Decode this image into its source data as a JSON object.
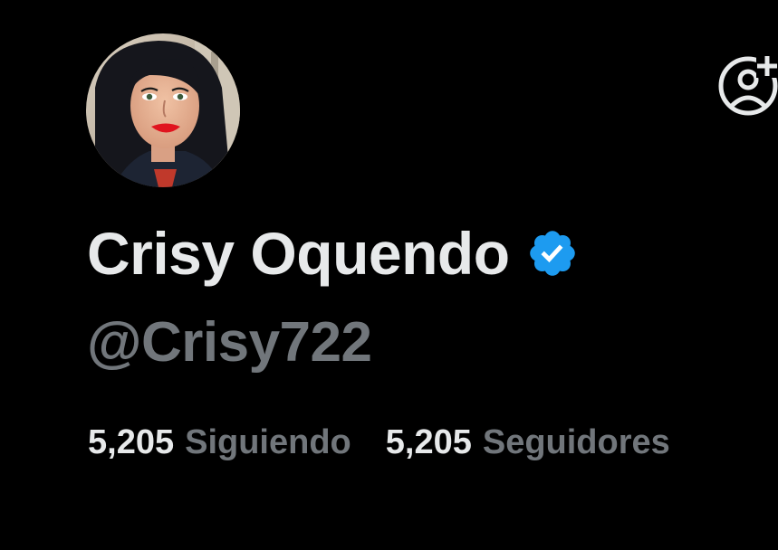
{
  "profile": {
    "display_name": "Crisy Oquendo",
    "handle": "@Crisy722",
    "verified": true
  },
  "stats": {
    "following_count": "5,205",
    "following_label": "Siguiendo",
    "followers_count": "5,205",
    "followers_label": "Seguidores"
  },
  "icons": {
    "avatar": "profile-photo",
    "verified": "verified-badge-icon",
    "follow": "add-user-icon"
  },
  "colors": {
    "background": "#000000",
    "primary_text": "#e7e9ea",
    "secondary_text": "#71767b",
    "verified_blue": "#1d9bf0"
  }
}
